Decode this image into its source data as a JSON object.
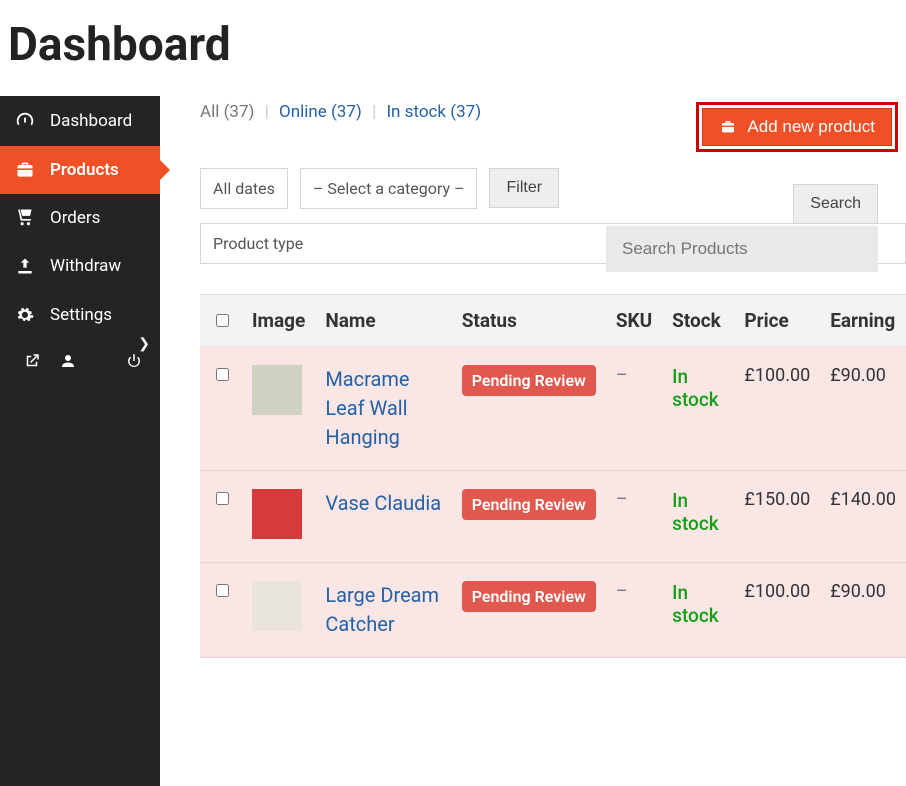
{
  "page_title": "Dashboard",
  "sidebar": {
    "items": [
      {
        "label": "Dashboard",
        "icon": "gauge"
      },
      {
        "label": "Products",
        "icon": "briefcase",
        "active": true
      },
      {
        "label": "Orders",
        "icon": "cart"
      },
      {
        "label": "Withdraw",
        "icon": "upload"
      },
      {
        "label": "Settings",
        "icon": "gear"
      }
    ]
  },
  "tabs": {
    "all_label": "All (37)",
    "online_label": "Online (37)",
    "instock_label": "In stock (37)"
  },
  "add_button_label": "Add new product",
  "filters": {
    "all_dates": "All dates",
    "category_placeholder": "– Select a category –",
    "filter_btn": "Filter",
    "product_type": "Product type",
    "search_btn": "Search",
    "search_placeholder": "Search Products"
  },
  "table": {
    "headers": {
      "image": "Image",
      "name": "Name",
      "status": "Status",
      "sku": "SKU",
      "stock": "Stock",
      "price": "Price",
      "earning": "Earning"
    },
    "rows": [
      {
        "name": "Macrame Leaf Wall Hanging",
        "status": "Pending Review",
        "sku": "–",
        "stock": "In stock",
        "price": "£100.00",
        "earning": "£90.00",
        "thumb_bg": "#cfd2c2"
      },
      {
        "name": "Vase Claudia",
        "status": "Pending Review",
        "sku": "–",
        "stock": "In stock",
        "price": "£150.00",
        "earning": "£140.00",
        "thumb_bg": "#d63a3a"
      },
      {
        "name": "Large Dream Catcher",
        "status": "Pending Review",
        "sku": "–",
        "stock": "In stock",
        "price": "£100.00",
        "earning": "£90.00",
        "thumb_bg": "#e9e5de"
      }
    ]
  }
}
